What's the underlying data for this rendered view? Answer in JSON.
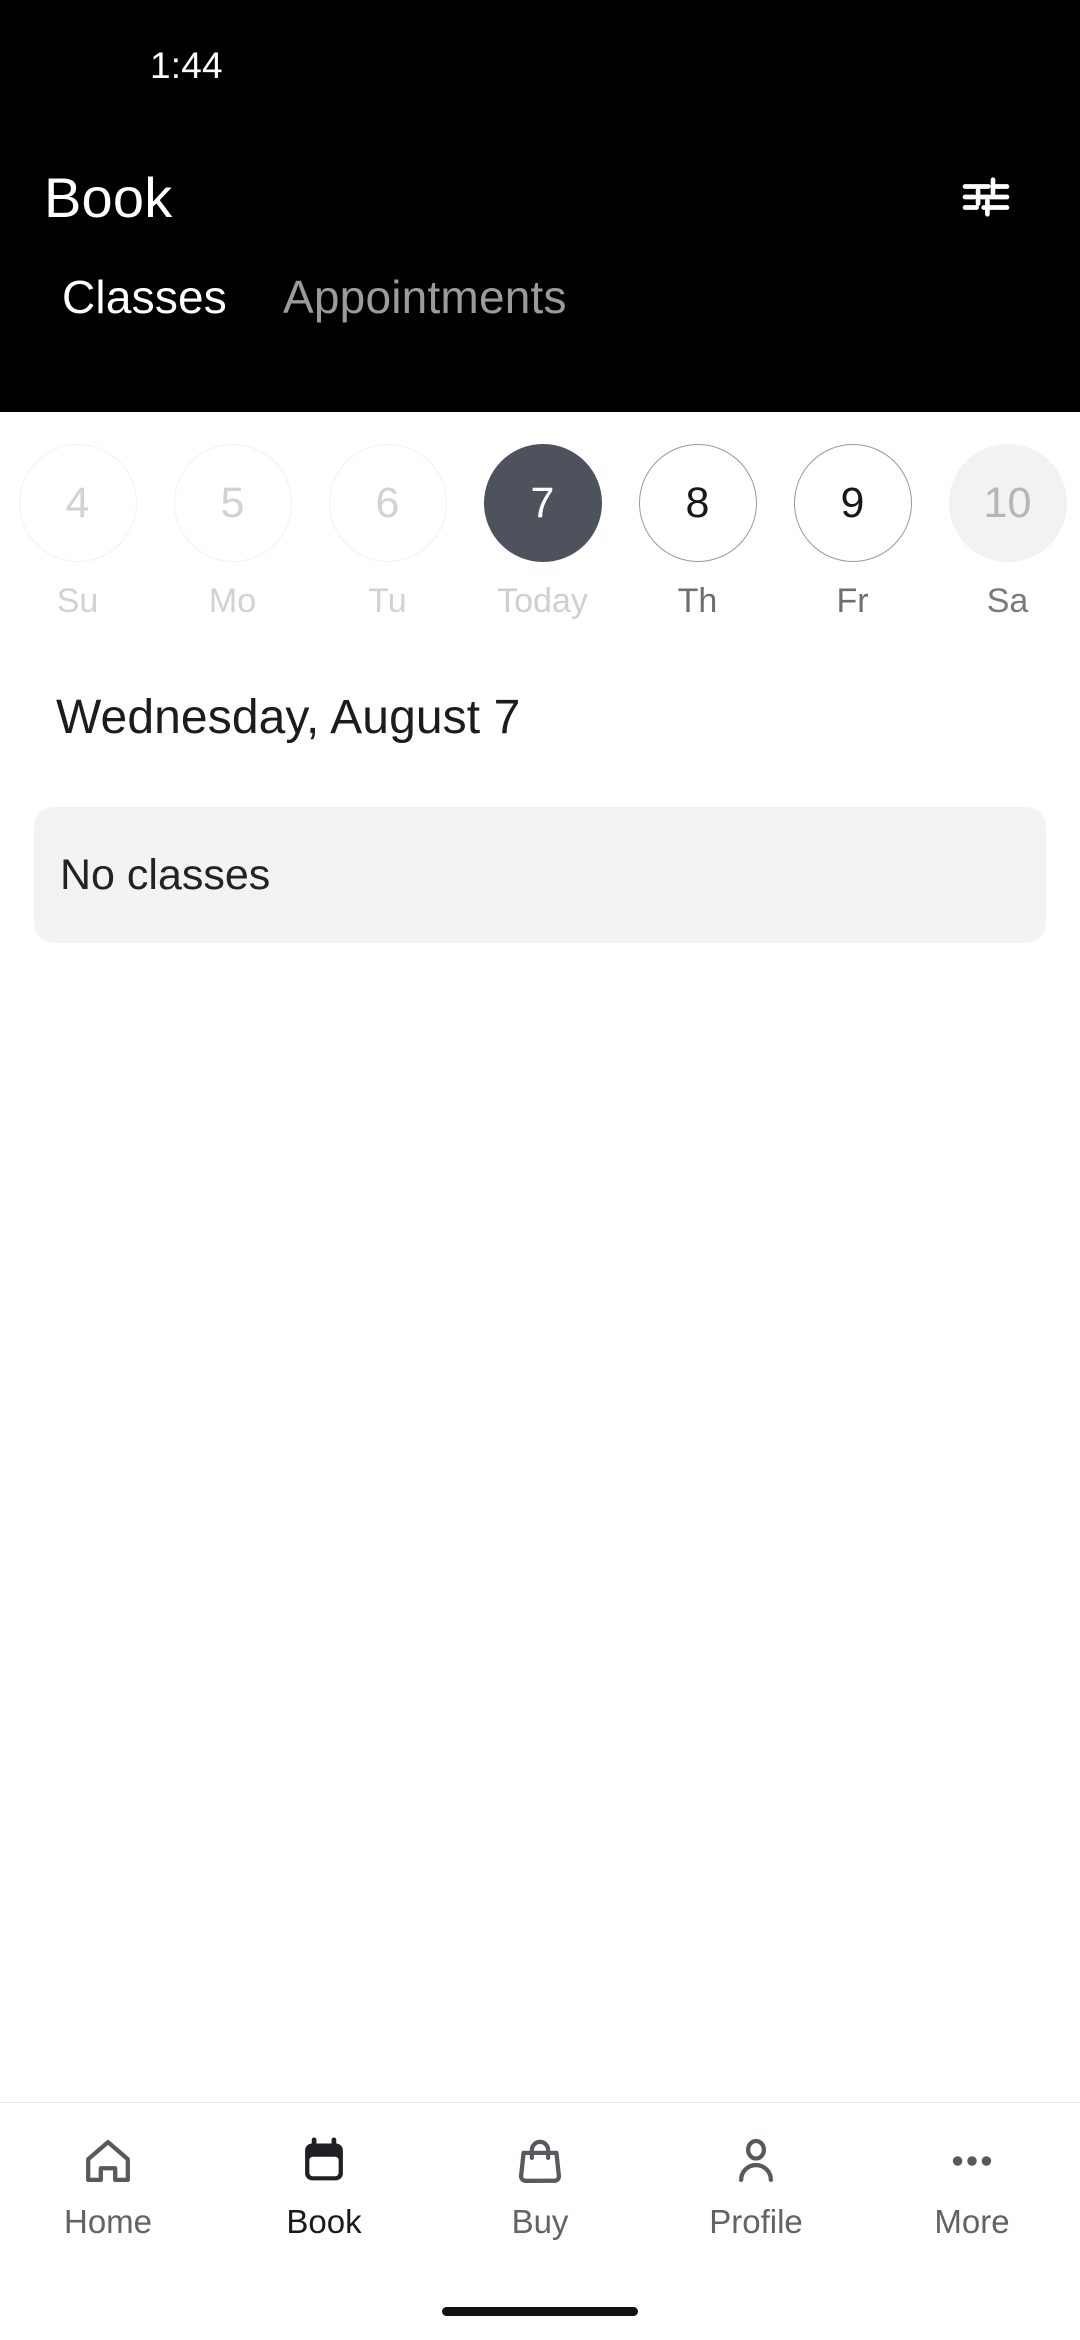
{
  "status_bar": {
    "time": "1:44"
  },
  "header": {
    "title": "Book",
    "filter_icon": "tune-sliders-icon",
    "tabs": [
      {
        "label": "Classes",
        "active": true
      },
      {
        "label": "Appointments",
        "active": false
      }
    ]
  },
  "date_strip": {
    "days": [
      {
        "number": "4",
        "label": "Su",
        "state": "past"
      },
      {
        "number": "5",
        "label": "Mo",
        "state": "past"
      },
      {
        "number": "6",
        "label": "Tu",
        "state": "past"
      },
      {
        "number": "7",
        "label": "Today",
        "state": "selected"
      },
      {
        "number": "8",
        "label": "Th",
        "state": "available"
      },
      {
        "number": "9",
        "label": "Fr",
        "state": "available"
      },
      {
        "number": "10",
        "label": "Sa",
        "state": "muted"
      }
    ]
  },
  "main": {
    "day_heading": "Wednesday, August 7",
    "empty_state": "No classes"
  },
  "bottom_nav": {
    "items": [
      {
        "label": "Home",
        "icon": "home-icon",
        "active": false
      },
      {
        "label": "Book",
        "icon": "calendar-icon",
        "active": true
      },
      {
        "label": "Buy",
        "icon": "shopping-bag-icon",
        "active": false
      },
      {
        "label": "Profile",
        "icon": "person-icon",
        "active": false
      },
      {
        "label": "More",
        "icon": "more-dots-icon",
        "active": false
      }
    ]
  },
  "colors": {
    "header_bg": "#000000",
    "selected_day": "#4d525c",
    "card_bg": "#f3f3f3",
    "active_nav": "#1a1a1a",
    "inactive_nav": "#636363"
  }
}
